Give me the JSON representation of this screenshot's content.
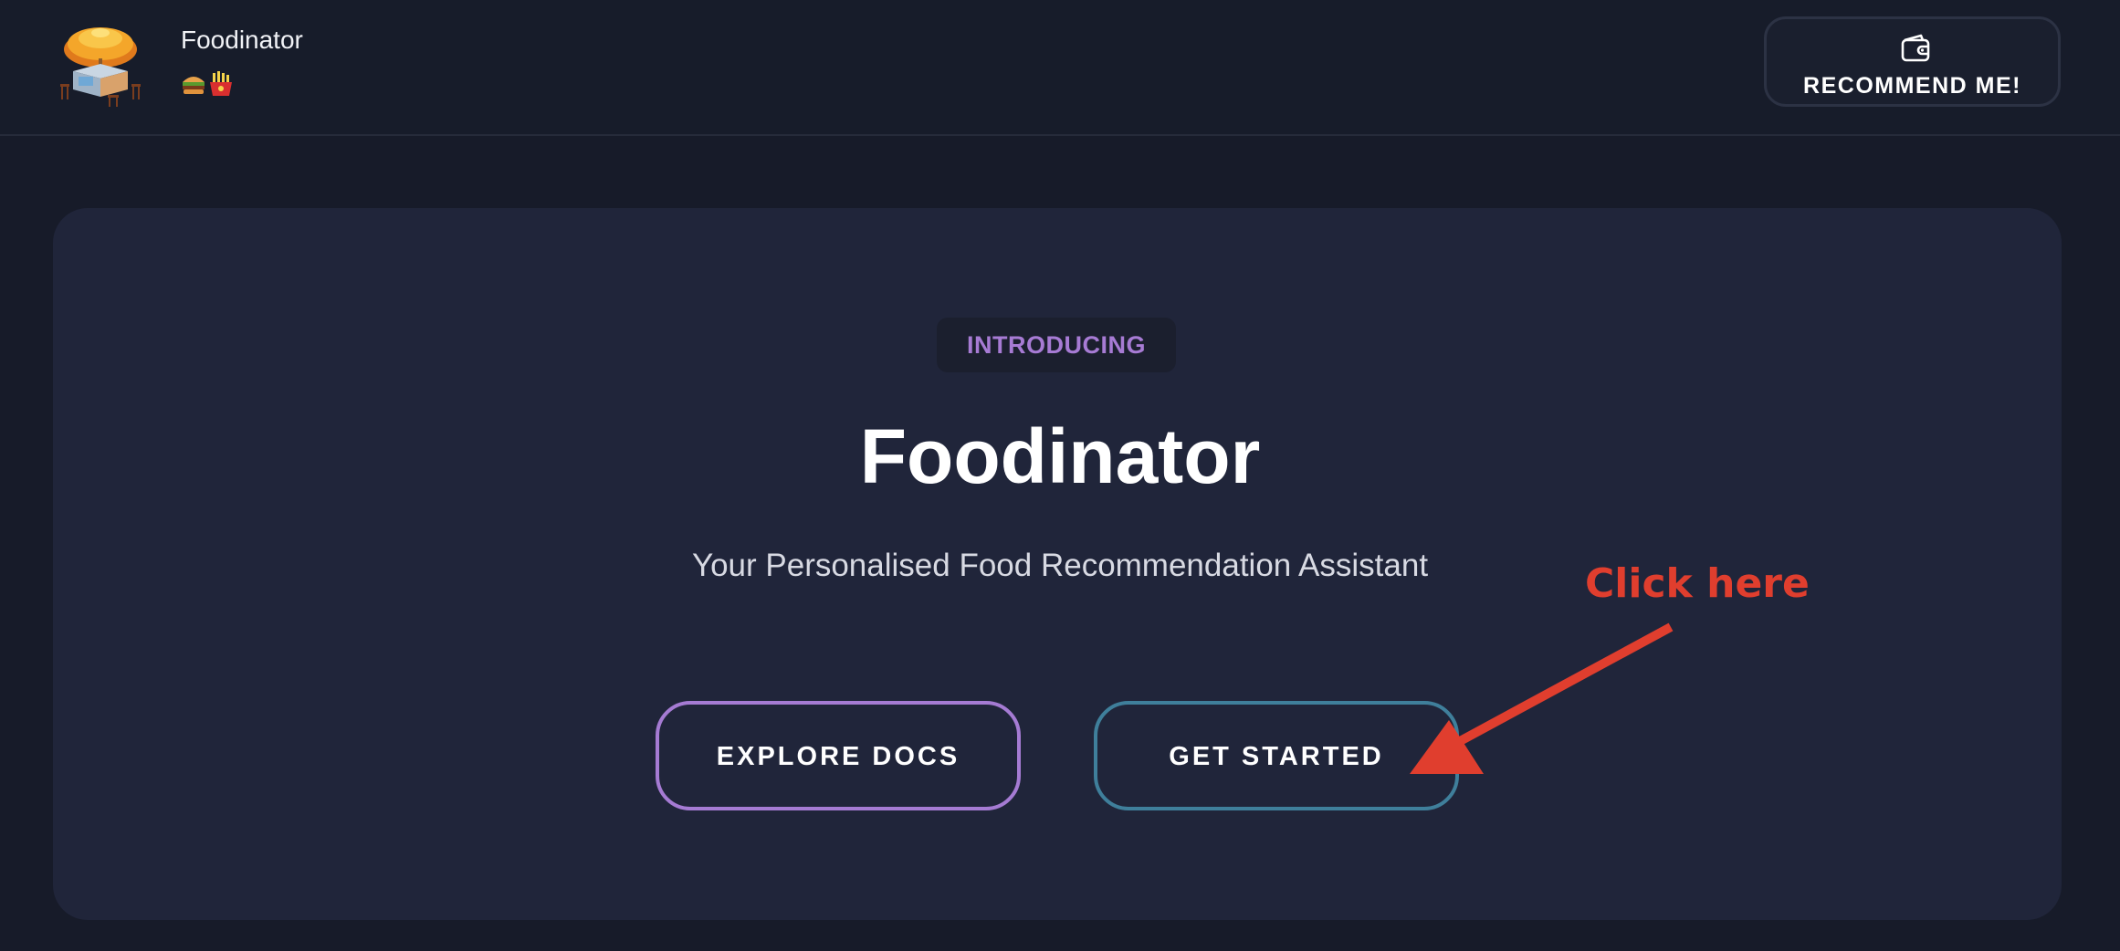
{
  "header": {
    "app_name": "Foodinator",
    "emoji_line": "🍔🍟",
    "recommend_label": "RECOMMEND ME!"
  },
  "hero": {
    "badge": "INTRODUCING",
    "title": "Foodinator",
    "subtitle": "Your Personalised Food Recommendation Assistant",
    "explore_label": "EXPLORE DOCS",
    "start_label": "GET STARTED"
  },
  "annotation": {
    "text": "Click here",
    "color": "#e03e2e"
  },
  "colors": {
    "background": "#171b29",
    "card": "#20253a",
    "accent_purple": "#a57bd3",
    "accent_teal": "#3f7f9b"
  },
  "icons": {
    "logo": "food-stall-logo-icon",
    "emoji": "burger-fries-emoji-icon",
    "recommend": "wallet-icon"
  }
}
